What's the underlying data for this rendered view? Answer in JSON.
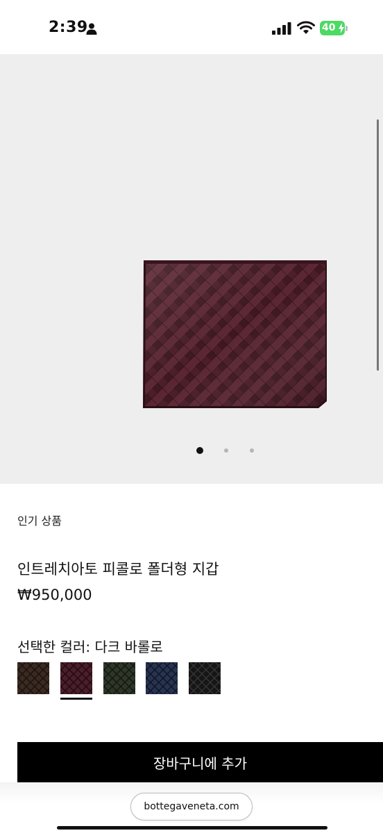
{
  "status_bar": {
    "time": "2:39",
    "battery_level": "40",
    "icons": [
      "person-icon",
      "cellular-signal-icon",
      "wifi-icon",
      "battery-charging-icon"
    ]
  },
  "gallery": {
    "image": "woven-leather-bifold-wallet",
    "slide_count": 3,
    "active_slide": 1
  },
  "product": {
    "badge": "인기 상품",
    "title": "인트레치아토 피콜로 폴더형 지갑",
    "price": "₩950,000",
    "selected_color_label": "선택한 컬러:",
    "selected_color_value": "다크 바롤로",
    "swatches": [
      {
        "color": "#3a2a22",
        "selected": false
      },
      {
        "color": "#4a1e2b",
        "selected": true
      },
      {
        "color": "#2e3628",
        "selected": false
      },
      {
        "color": "#27334f",
        "selected": false
      },
      {
        "color": "#161616",
        "selected": false
      }
    ]
  },
  "actions": {
    "add_to_cart": "장바구니에 추가"
  },
  "browser": {
    "url": "bottegaveneta.com"
  },
  "colors": {
    "accent": "#000000",
    "gallery_bg": "#eeeeee",
    "battery": "#4cd964"
  }
}
